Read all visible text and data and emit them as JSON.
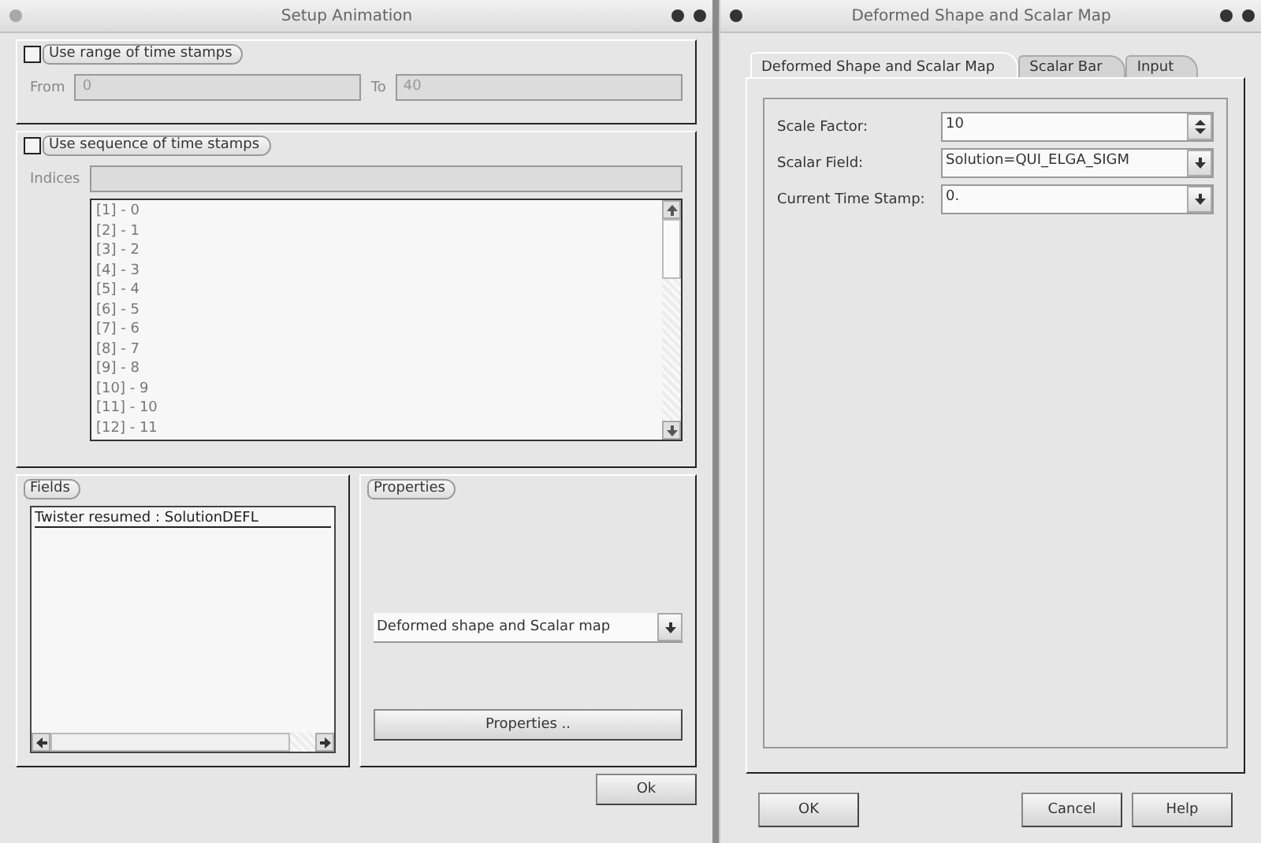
{
  "left_window": {
    "title": "Setup Animation",
    "range_group": {
      "label": "Use range of time stamps",
      "checked": false,
      "from_label": "From",
      "from_value": "0",
      "to_label": "To",
      "to_value": "40"
    },
    "sequence_group": {
      "label": "Use sequence of time stamps",
      "checked": false,
      "indices_label": "Indices",
      "items": [
        "[1] - 0",
        "[2] - 1",
        "[3] - 2",
        "[4] - 3",
        "[5] - 4",
        "[6] - 5",
        "[7] - 6",
        "[8] - 7",
        "[9] - 8",
        "[10] - 9",
        "[11] - 10",
        "[12] - 11"
      ]
    },
    "fields_group": {
      "label": "Fields",
      "items": [
        "Twister resumed : SolutionDEFL"
      ]
    },
    "properties_group": {
      "label": "Properties",
      "dropdown_value": "Deformed shape and Scalar map",
      "button": "Properties .."
    },
    "ok_button": "Ok"
  },
  "right_window": {
    "title": "Deformed Shape and Scalar Map",
    "tabs": [
      {
        "label": "Deformed Shape and Scalar Map",
        "selected": true
      },
      {
        "label": "Scalar Bar",
        "selected": false
      },
      {
        "label": "Input",
        "selected": false
      }
    ],
    "rows": [
      {
        "kind": "spin",
        "label": "Scale Factor:",
        "value": "10"
      },
      {
        "kind": "combo",
        "label": "Scalar Field:",
        "value": "Solution=QUI_ELGA_SIGM"
      },
      {
        "kind": "combo",
        "label": "Current Time Stamp:",
        "value": "0."
      }
    ],
    "buttons": [
      "OK",
      "Cancel",
      "Help"
    ]
  }
}
